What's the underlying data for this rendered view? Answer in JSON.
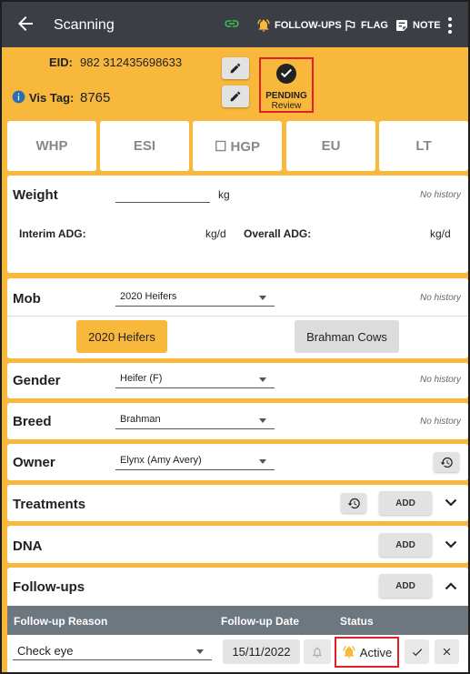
{
  "topbar": {
    "title": "Scanning",
    "followups_label": "FOLLOW-UPS",
    "flag_label": "FLAG",
    "note_label": "NOTE",
    "colors": {
      "bar": "#3b3f45",
      "link_icon": "#3ec94a",
      "bell_icon": "#f8b83c"
    }
  },
  "header": {
    "eid_label": "EID:",
    "eid_value": "982 312435698633",
    "vis_tag_label": "Vis Tag:",
    "vis_tag_value": "8765",
    "pending_label": "PENDING",
    "pending_sub": "Review"
  },
  "status_tiles": [
    "WHP",
    "ESI",
    "☐ HGP",
    "EU",
    "LT"
  ],
  "weight": {
    "label": "Weight",
    "unit": "kg",
    "value": "",
    "no_history": "No history",
    "interim_label": "Interim ADG:",
    "interim_unit": "kg/d",
    "overall_label": "Overall ADG:",
    "overall_unit": "kg/d"
  },
  "mob": {
    "label": "Mob",
    "selected": "2020 Heifers",
    "no_history": "No history",
    "chips": [
      "2020 Heifers",
      "Brahman Cows"
    ],
    "active_chip": "2020 Heifers"
  },
  "gender": {
    "label": "Gender",
    "selected": "Heifer (F)",
    "no_history": "No history"
  },
  "breed": {
    "label": "Breed",
    "selected": "Brahman",
    "no_history": "No history"
  },
  "owner": {
    "label": "Owner",
    "selected": "Elynx (Amy  Avery)"
  },
  "treatments": {
    "label": "Treatments",
    "add_label": "ADD"
  },
  "dna": {
    "label": "DNA",
    "add_label": "ADD"
  },
  "followups": {
    "label": "Follow-ups",
    "add_label": "ADD",
    "columns": [
      "Follow-up Reason",
      "Follow-up Date",
      "Status"
    ],
    "rows": [
      {
        "reason": "Check eye",
        "date": "15/11/2022",
        "status": "Active"
      }
    ]
  },
  "colors": {
    "accent": "#f8b83c",
    "highlight": "#e01f26",
    "chip_active": "#f8b83c",
    "table_header": "#6d7780"
  }
}
